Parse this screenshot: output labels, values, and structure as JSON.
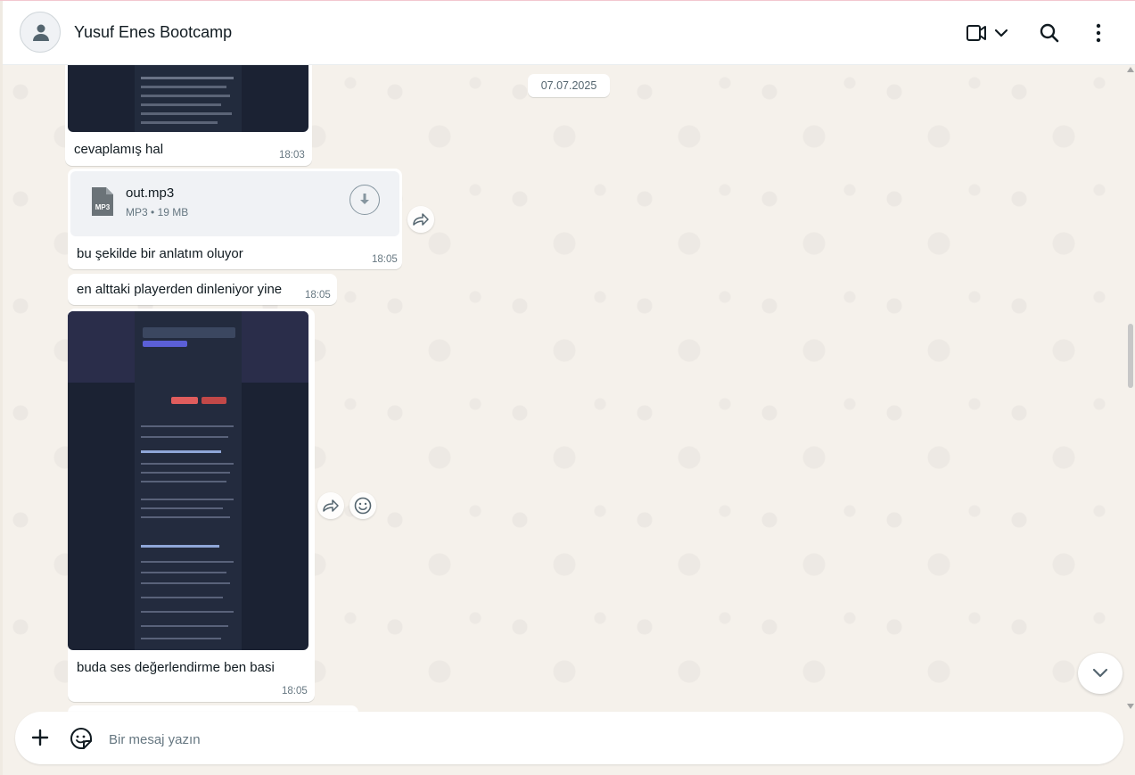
{
  "header": {
    "contact_name": "Yusuf Enes Bootcamp",
    "icons": [
      "avatar-icon",
      "video-call-icon",
      "chevron-down-icon",
      "search-icon",
      "more-vertical-icon"
    ]
  },
  "chat": {
    "date_separator": "07.07.2025",
    "messages": [
      {
        "type": "image",
        "caption": "cevaplamış hal",
        "time": "18:03"
      },
      {
        "type": "document",
        "file_name": "out.mp3",
        "file_ext": "MP3",
        "file_meta_type": "MP3",
        "file_meta_size": "19 MB",
        "caption": "bu şekilde bir anlatım oluyor",
        "time": "18:05"
      },
      {
        "type": "text",
        "text": "en alttaki playerden dinleniyor yine",
        "time": "18:05"
      },
      {
        "type": "image",
        "caption": "buda ses değerlendirme ben basi",
        "time": "18:05"
      }
    ]
  },
  "composer": {
    "placeholder": "Bir mesaj yazın",
    "icons": [
      "plus-icon",
      "sticker-icon"
    ]
  },
  "colors": {
    "header_bg": "#ffffff",
    "chat_bg": "#f5f1eb",
    "bubble_bg": "#ffffff",
    "text": "#111b21",
    "meta_text": "#667781"
  }
}
